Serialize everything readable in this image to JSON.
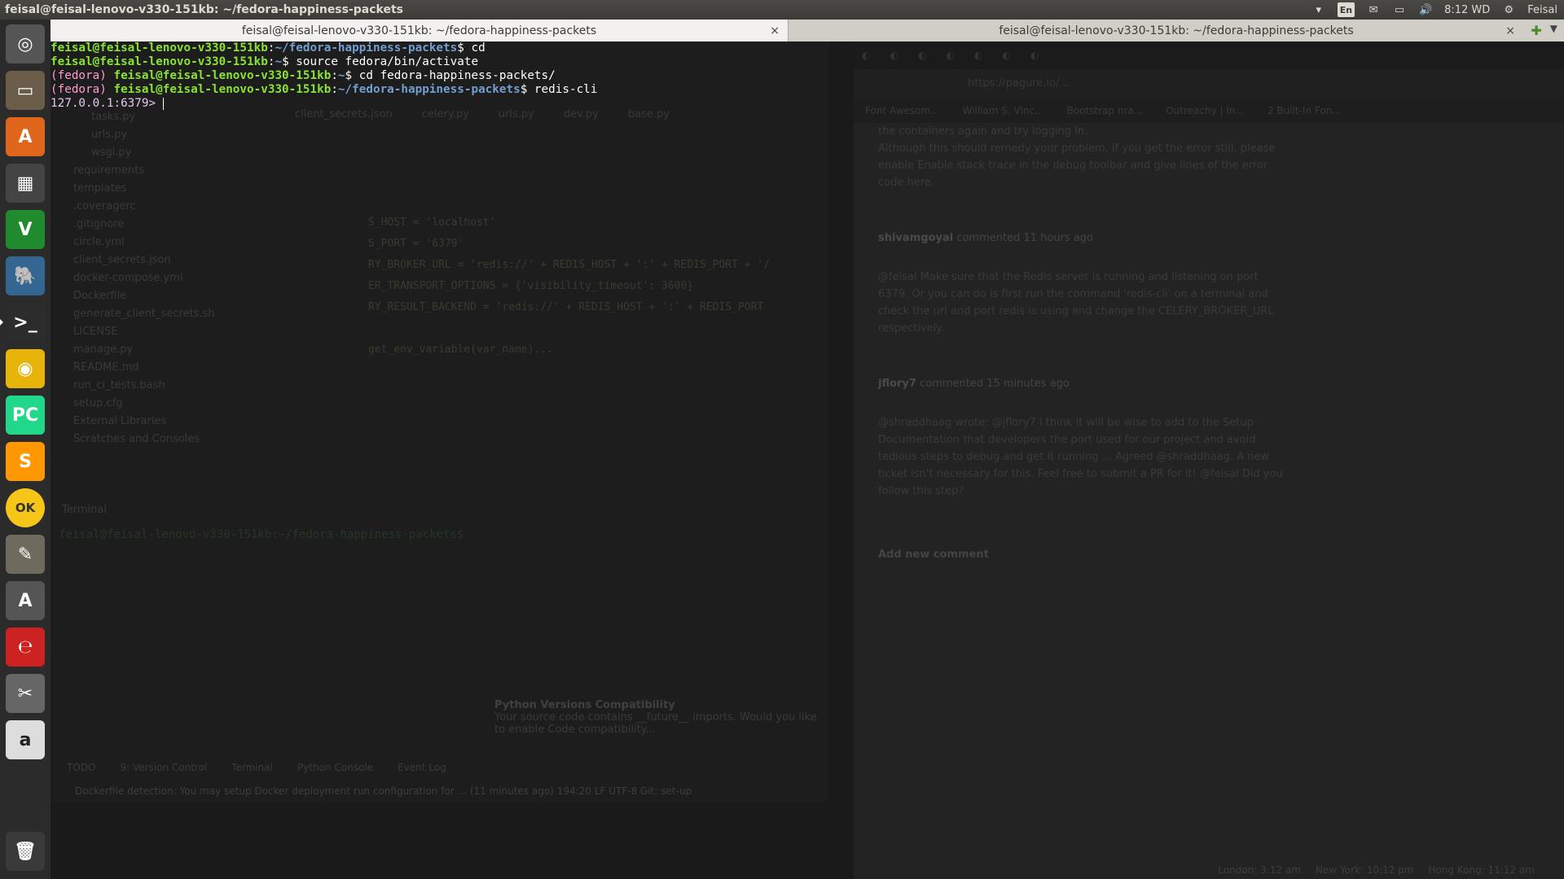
{
  "top_panel": {
    "title": "feisal@feisal-lenovo-v330-151kb: ~/fedora-happiness-packets",
    "keyboard": "En",
    "time": "8:12 WD",
    "user": "Feisal"
  },
  "launcher": {
    "items": [
      {
        "name": "dash-icon",
        "glyph": "◎",
        "color": "#555"
      },
      {
        "name": "files-icon",
        "glyph": "▭",
        "color": "#6b5d4a"
      },
      {
        "name": "software-center-icon",
        "glyph": "A",
        "color": "#e0661b"
      },
      {
        "name": "video-editor-icon",
        "glyph": "▦",
        "color": "#444"
      },
      {
        "name": "vim-icon",
        "glyph": "V",
        "color": "#1f8a2e"
      },
      {
        "name": "postgresql-icon",
        "glyph": "🐘",
        "color": "#336791"
      },
      {
        "name": "terminal-icon",
        "glyph": ">_",
        "color": "#2c2c2c"
      },
      {
        "name": "chrome-icon",
        "glyph": "◉",
        "color": "#e7b40a"
      },
      {
        "name": "pycharm-icon",
        "glyph": "PC",
        "color": "#21d789"
      },
      {
        "name": "sublime-icon",
        "glyph": "S",
        "color": "#ff9800"
      },
      {
        "name": "ok-icon",
        "glyph": "OK",
        "color": "#f5c518"
      },
      {
        "name": "gimp-icon",
        "glyph": "✎",
        "color": "#6e6a5d"
      },
      {
        "name": "updater-icon",
        "glyph": "A",
        "color": "#555"
      },
      {
        "name": "evince-icon",
        "glyph": "℮",
        "color": "#c22"
      },
      {
        "name": "tools-icon",
        "glyph": "✂",
        "color": "#666"
      },
      {
        "name": "amazon-icon",
        "glyph": "a",
        "color": "#ddd"
      }
    ],
    "trash": {
      "name": "trash-icon",
      "glyph": "🗑"
    }
  },
  "tabs": [
    {
      "title": "feisal@feisal-lenovo-v330-151kb: ~/fedora-happiness-packets",
      "close": "×"
    },
    {
      "title": "feisal@feisal-lenovo-v330-151kb: ~/fedora-happiness-packets",
      "close": "×"
    }
  ],
  "terminal": {
    "lines": [
      {
        "prefix": "",
        "user": "feisal@feisal-lenovo-v330-151kb",
        "path": "~/fedora-happiness-packets",
        "cmd": "$ cd"
      },
      {
        "prefix": "",
        "user": "feisal@feisal-lenovo-v330-151kb",
        "path": "~",
        "cmd": "$ source fedora/bin/activate"
      },
      {
        "prefix": "(fedora) ",
        "user": "feisal@feisal-lenovo-v330-151kb",
        "path": "~",
        "cmd": "$ cd fedora-happiness-packets/"
      },
      {
        "prefix": "(fedora) ",
        "user": "feisal@feisal-lenovo-v330-151kb",
        "path": "~/fedora-happiness-packets",
        "cmd": "$ redis-cli"
      }
    ],
    "prompt": "127.0.0.1:6379> "
  },
  "ide": {
    "tree": [
      "tasks.py",
      "urls.py",
      "wsgi.py",
      "requirements",
      "templates",
      ".coveragerc",
      ".gitignore",
      "circle.yml",
      "client_secrets.json",
      "docker-compose.yml",
      "Dockerfile",
      "generate_client_secrets.sh",
      "LICENSE",
      "manage.py",
      "README.md",
      "run_ci_tests.bash",
      "setup.cfg",
      "External Libraries",
      "Scratches and Consoles"
    ],
    "tabs": [
      "client_secrets.json",
      "celery.py",
      "urls.py",
      "dev.py",
      "base.py"
    ],
    "code": [
      "S_HOST = 'localhost'",
      "S_PORT = '6379'",
      "RY_BROKER_URL = 'redis://' + REDIS_HOST + ':' + REDIS_PORT + '/",
      "ER_TRANSPORT_OPTIONS = {'visibility_timeout': 3600}",
      "RY_RESULT_BACKEND = 'redis://' + REDIS_HOST + ':' + REDIS_PORT",
      "",
      "get_env_variable(var_name)..."
    ],
    "terminal_label": "Terminal",
    "terminal_line": "feisal@feisal-lenovo-v330-151kb:~/fedora-happiness-packets$",
    "popup_title": "Python Versions Compatibility",
    "popup_text": "Your source code contains __future__ imports. Would you like to enable Code compatibility...",
    "bottom_tabs": [
      "TODO",
      "9: Version Control",
      "Terminal",
      "Python Console",
      "Event Log"
    ],
    "status": "Dockerfile detection: You may setup Docker deployment run configuration for ... (11 minutes ago)   194:20  LF  UTF-8  Git: set-up"
  },
  "browser": {
    "url": "https://pagure.io/...",
    "bookmarks": [
      "Font Awesom...",
      "William S. Vinc...",
      "Bootstrap nra...",
      "Outreachy | In...",
      "2 Built-In Fon..."
    ],
    "content": [
      "the containers again and try logging in.",
      "Although this should remedy your problem, if you get the error still, please",
      "enable Enable stack trace in the debug toolbar and give lines of the error",
      "code here."
    ],
    "comments": [
      {
        "author": "shivamgoyal",
        "meta": "commented 11 hours ago",
        "body": "@feisal Make sure that the Redis server is running and listening on port 6379. Or you can do is first run the command 'redis-cli' on a terminal and check the url and port redis is using and change the CELERY_BROKER_URL respectively."
      },
      {
        "author": "jflory7",
        "meta": "commented 15 minutes ago",
        "body": "@shraddhaag wrote: @jflory7 I think it will be wise to add to the Setup Documentation that developers the port used for our project and avoid tedious steps to debug and get it running ... Agreed @shraddhaag. A new ticket isn't necessary for this. Feel free to submit a PR for it! @feisal Did you follow this step?"
      }
    ],
    "add_comment": "Add new comment",
    "clocks": [
      "London: 3:12 am",
      "New York: 10:12 pm",
      "Hong Kong: 11:12 am"
    ]
  }
}
